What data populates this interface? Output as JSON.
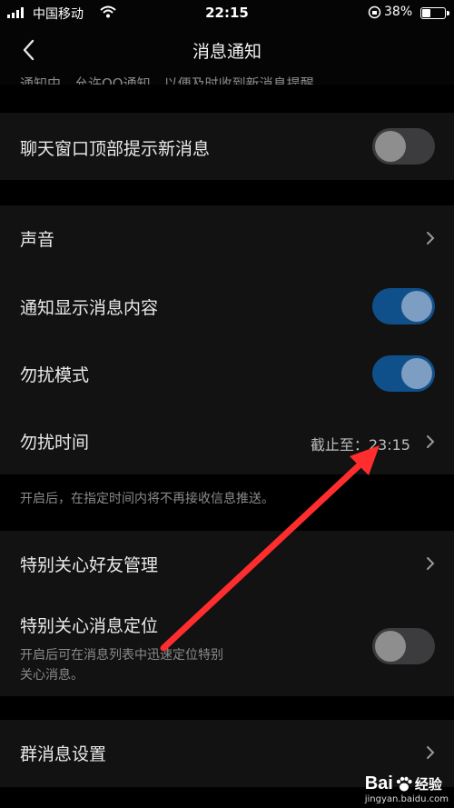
{
  "status_bar": {
    "carrier": "中国移动",
    "time": "22:15",
    "battery": "38%",
    "battery_level": 0.38
  },
  "nav": {
    "title": "消息通知"
  },
  "top_hint_partial": "通知中，允许QQ通知，以便及时收到新消息提醒。",
  "rows": {
    "chat_top": {
      "label": "聊天窗口顶部提示新消息",
      "toggle": "off"
    },
    "sound": {
      "label": "声音"
    },
    "show_content": {
      "label": "通知显示消息内容",
      "toggle": "on"
    },
    "dnd_mode": {
      "label": "勿扰模式",
      "toggle": "on"
    },
    "dnd_time": {
      "label": "勿扰时间",
      "value": "截止至：23:15"
    },
    "dnd_hint": "开启后，在指定时间内将不再接收信息推送。",
    "special_friends": {
      "label": "特别关心好友管理"
    },
    "special_locate": {
      "label": "特别关心消息定位",
      "hint_line1": "开启后可在消息列表中迅速定位特别",
      "hint_line2": "关心消息。",
      "toggle": "off"
    },
    "group_settings": {
      "label": "群消息设置"
    }
  },
  "annotation": {
    "color": "#ff2d2d"
  },
  "watermark": {
    "main_a": "Bai",
    "main_b": "经验",
    "sub": "jingyan.baidu.com"
  }
}
